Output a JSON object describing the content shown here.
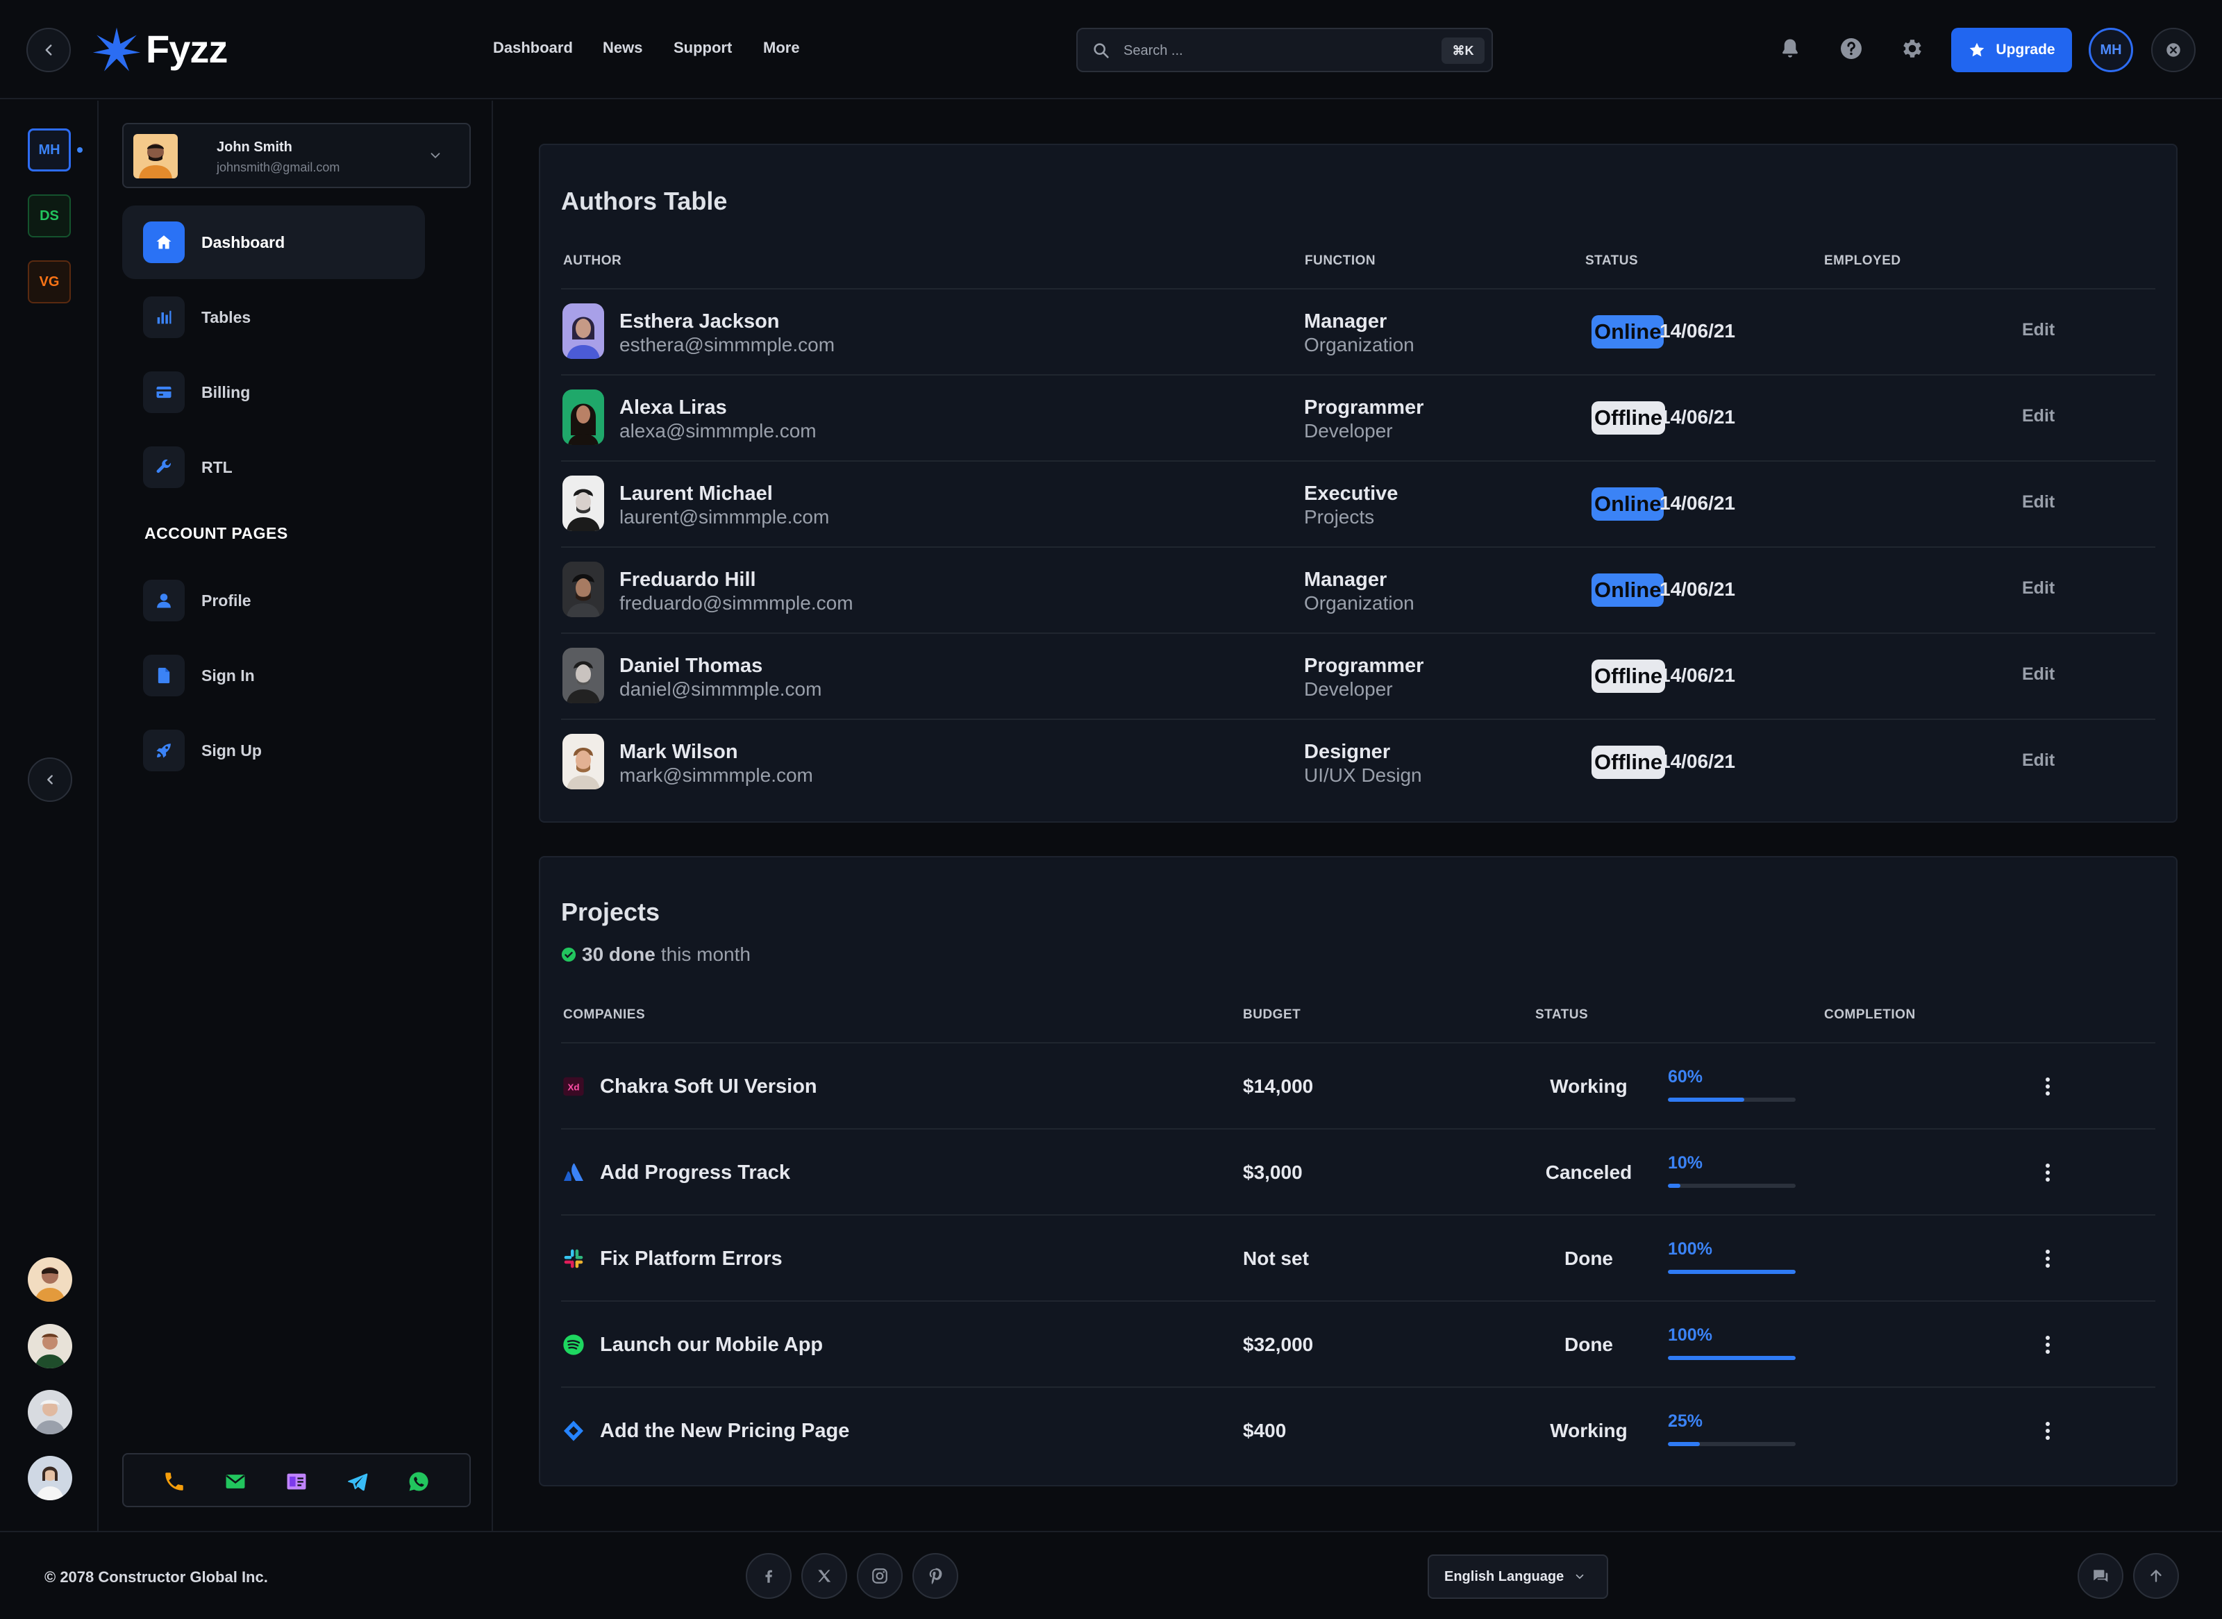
{
  "brand": {
    "name": "Fyzz",
    "accent": "#2166f0"
  },
  "topnav": {
    "links": [
      "Dashboard",
      "News",
      "Support",
      "More"
    ]
  },
  "search": {
    "placeholder": "Search ...",
    "shortcut": "⌘K"
  },
  "topbar": {
    "upgrade_label": "Upgrade",
    "user_initials": "MH",
    "icons": [
      "bell-icon",
      "help-icon",
      "gear-icon",
      "close-icon"
    ]
  },
  "rail": {
    "workspaces": [
      {
        "label": "MH",
        "color": "#3b83f6"
      },
      {
        "label": "DS",
        "color": "#22c55e"
      },
      {
        "label": "VG",
        "color": "#f97316"
      }
    ]
  },
  "sidebar": {
    "user": {
      "name": "John Smith",
      "email": "johnsmith@gmail.com"
    },
    "items": [
      {
        "label": "Dashboard",
        "icon": "home-icon",
        "active": true
      },
      {
        "label": "Tables",
        "icon": "bar-chart-icon"
      },
      {
        "label": "Billing",
        "icon": "credit-card-icon"
      },
      {
        "label": "RTL",
        "icon": "wrench-icon"
      }
    ],
    "section_title": "ACCOUNT PAGES",
    "account_items": [
      {
        "label": "Profile",
        "icon": "user-icon"
      },
      {
        "label": "Sign In",
        "icon": "document-icon"
      },
      {
        "label": "Sign Up",
        "icon": "rocket-icon"
      }
    ],
    "contacts": [
      "phone-icon",
      "mail-icon",
      "contact-card-icon",
      "telegram-icon",
      "whatsapp-icon"
    ]
  },
  "authors": {
    "title": "Authors Table",
    "columns": [
      "AUTHOR",
      "FUNCTION",
      "STATUS",
      "EMPLOYED"
    ],
    "rows": [
      {
        "name": "Esthera Jackson",
        "email": "esthera@simmmple.com",
        "role": "Manager",
        "dept": "Organization",
        "status": "Online",
        "employed": "14/06/21",
        "action": "Edit"
      },
      {
        "name": "Alexa Liras",
        "email": "alexa@simmmple.com",
        "role": "Programmer",
        "dept": "Developer",
        "status": "Offline",
        "employed": "14/06/21",
        "action": "Edit"
      },
      {
        "name": "Laurent Michael",
        "email": "laurent@simmmple.com",
        "role": "Executive",
        "dept": "Projects",
        "status": "Online",
        "employed": "14/06/21",
        "action": "Edit"
      },
      {
        "name": "Freduardo Hill",
        "email": "freduardo@simmmple.com",
        "role": "Manager",
        "dept": "Organization",
        "status": "Online",
        "employed": "14/06/21",
        "action": "Edit"
      },
      {
        "name": "Daniel Thomas",
        "email": "daniel@simmmple.com",
        "role": "Programmer",
        "dept": "Developer",
        "status": "Offline",
        "employed": "14/06/21",
        "action": "Edit"
      },
      {
        "name": "Mark Wilson",
        "email": "mark@simmmple.com",
        "role": "Designer",
        "dept": "UI/UX Design",
        "status": "Offline",
        "employed": "14/06/21",
        "action": "Edit"
      }
    ]
  },
  "projects": {
    "title": "Projects",
    "summary_count": "30 done",
    "summary_rest": "this month",
    "columns": [
      "COMPANIES",
      "BUDGET",
      "STATUS",
      "COMPLETION"
    ],
    "rows": [
      {
        "name": "Chakra Soft UI Version",
        "icon": "adobe-xd-icon",
        "budget": "$14,000",
        "status": "Working",
        "completion_label": "60%",
        "completion": 60
      },
      {
        "name": "Add Progress Track",
        "icon": "atlassian-icon",
        "budget": "$3,000",
        "status": "Canceled",
        "completion_label": "10%",
        "completion": 10
      },
      {
        "name": "Fix Platform Errors",
        "icon": "slack-icon",
        "budget": "Not set",
        "status": "Done",
        "completion_label": "100%",
        "completion": 100
      },
      {
        "name": "Launch our Mobile App",
        "icon": "spotify-icon",
        "budget": "$32,000",
        "status": "Done",
        "completion_label": "100%",
        "completion": 100
      },
      {
        "name": "Add the New Pricing Page",
        "icon": "jira-icon",
        "budget": "$400",
        "status": "Working",
        "completion_label": "25%",
        "completion": 25
      }
    ]
  },
  "footer": {
    "copyright": "© 2078 Constructor Global Inc.",
    "social": [
      "facebook-icon",
      "x-icon",
      "instagram-icon",
      "pinterest-icon"
    ],
    "language": "English Language"
  }
}
